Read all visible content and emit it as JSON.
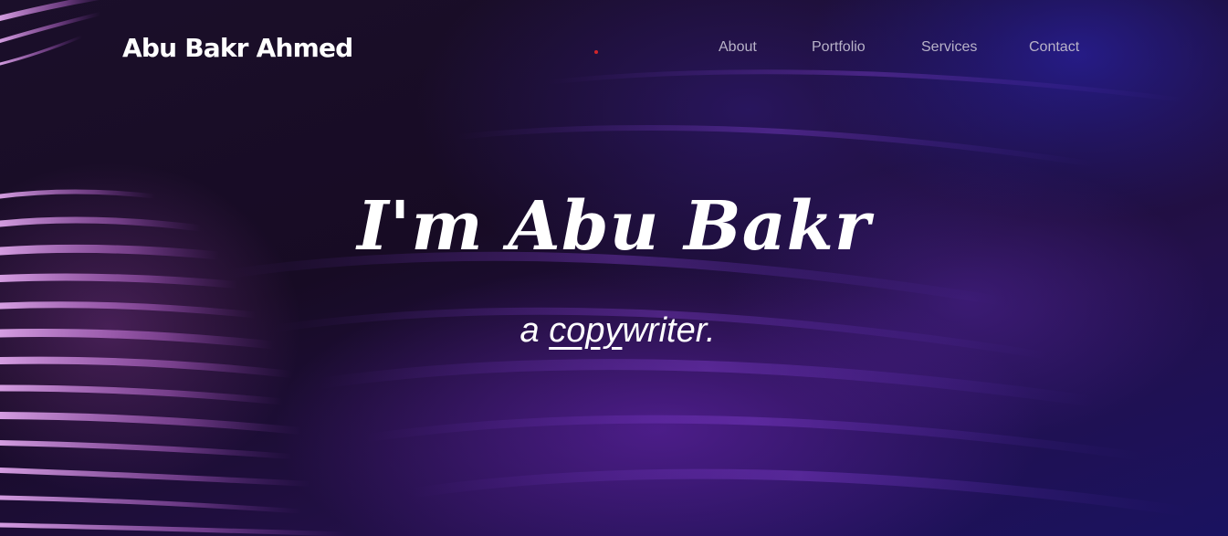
{
  "header": {
    "brand": "Abu Bakr Ahmed",
    "nav": [
      {
        "label": "About"
      },
      {
        "label": "Portfolio"
      },
      {
        "label": "Services"
      },
      {
        "label": "Contact"
      }
    ]
  },
  "hero": {
    "headline": "I'm Abu Bakr",
    "sub_prefix": "a ",
    "sub_typed": "copy",
    "sub_rest": "writer."
  },
  "colors": {
    "nav_text": "#b8b2c8",
    "heading_text": "#ffffff",
    "indicator_dot": "#d2262a"
  }
}
